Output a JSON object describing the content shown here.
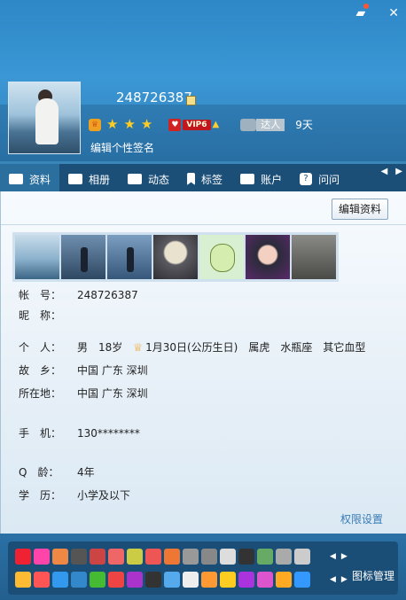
{
  "window": {
    "skin_icon": "shirt-skin-icon",
    "close_icon": "close-icon"
  },
  "profile": {
    "qq_number": "248726387",
    "level_stars": 3,
    "vip_label": "VIP6",
    "daren_label": "达人",
    "daren_days": "9天",
    "signature_placeholder": "编辑个性签名"
  },
  "tabs": [
    {
      "label": "资料",
      "icon": "id-card-icon",
      "active": true
    },
    {
      "label": "相册",
      "icon": "photo-album-icon",
      "active": false
    },
    {
      "label": "动态",
      "icon": "list-icon",
      "active": false
    },
    {
      "label": "标签",
      "icon": "bookmark-icon",
      "active": false
    },
    {
      "label": "账户",
      "icon": "briefcase-icon",
      "active": false
    },
    {
      "label": "问问",
      "icon": "question-icon",
      "active": false
    }
  ],
  "content": {
    "edit_button": "编辑资料",
    "photo_count": 7,
    "fields": {
      "account": {
        "label": "帐　号：",
        "value": "248726387"
      },
      "nickname": {
        "label": "昵　称：",
        "value": ""
      },
      "personal": {
        "label": "个　人：",
        "gender": "男",
        "age": "18岁",
        "birthday": "1月30日(公历生日)",
        "zodiac": "属虎",
        "constellation": "水瓶座",
        "blood": "其它血型"
      },
      "hometown": {
        "label": "故　乡：",
        "value": "中国 广东 深圳"
      },
      "location": {
        "label": "所在地：",
        "value": "中国 广东 深圳"
      },
      "phone": {
        "label": "手　机：",
        "value": "130********"
      },
      "qage": {
        "label": "Q　龄：",
        "value": "4年"
      },
      "education": {
        "label": "学　历：",
        "value": "小学及以下"
      }
    },
    "permission_link": "权限设置"
  },
  "bottom": {
    "manage_label": "图标管理",
    "row1_colors": [
      "#e23",
      "#f4a",
      "#e84",
      "#555",
      "#c44",
      "#e66",
      "#cc4",
      "#e55",
      "#e73",
      "#999",
      "#888",
      "#ddd",
      "#333",
      "#6a6",
      "#aaa",
      "#ccc"
    ],
    "row2_colors": [
      "#fb3",
      "#f55",
      "#39e",
      "#38c",
      "#4b3",
      "#e44",
      "#a3c",
      "#333",
      "#5ae",
      "#eee",
      "#f93",
      "#fc2",
      "#a3d",
      "#d5c",
      "#fa2",
      "#39f"
    ]
  }
}
